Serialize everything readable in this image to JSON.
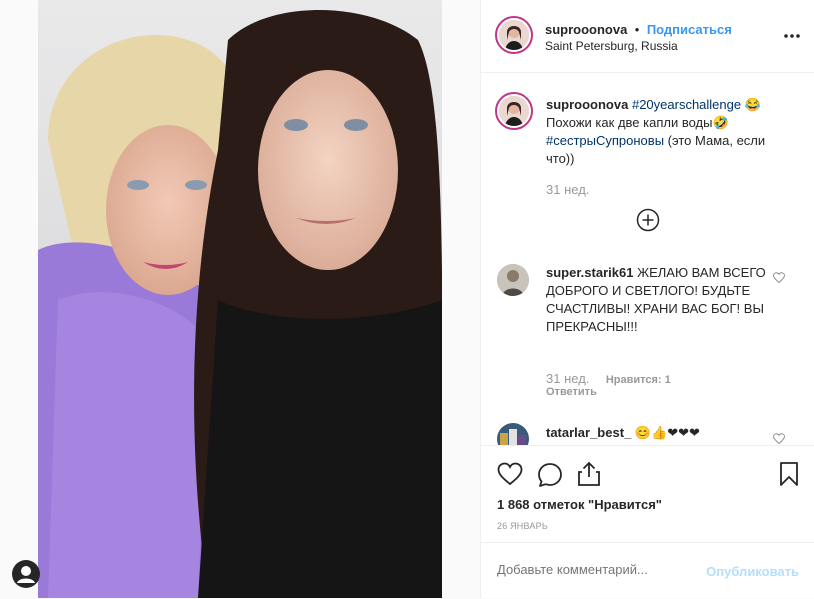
{
  "post": {
    "username": "suprooonova",
    "follow_label": "Подписаться",
    "dot": "•",
    "location": "Saint Petersburg, Russia",
    "more_icon": "more-horizontal-icon"
  },
  "caption": {
    "username": "suprooonova",
    "hashtag1": "#20yearschallenge",
    "emoji1": "😂",
    "line2": "Похожи как две капли воды🤣",
    "hashtag2": "#сестрыСупроновы",
    "line3_rest": " (это Мама, если что))",
    "time": "31 нед.",
    "load_more_icon": "plus-circle-icon"
  },
  "comments": [
    {
      "username": "super.starik61",
      "text": " ЖЕЛАЮ ВАМ ВСЕГО ДОБРОГО И СВЕТЛОГО! БУДЬТЕ СЧАСТЛИВЫ! ХРАНИ ВАС БОГ! ВЫ ПРЕКРАСНЫ!!!",
      "time": "31 нед.",
      "likes": "Нравится: 1",
      "reply": "Ответить"
    },
    {
      "username": "tatarlar_best_",
      "text": " 😊👍❤❤❤"
    }
  ],
  "actions": {
    "likes": "1 868 отметок \"Нравится\"",
    "date": "26 ЯНВАРЬ"
  },
  "add_comment": {
    "placeholder": "Добавьте комментарий...",
    "publish": "Опубликовать"
  },
  "colors": {
    "accent": "#3897f0",
    "hashtag": "#003569",
    "muted": "#999999"
  }
}
